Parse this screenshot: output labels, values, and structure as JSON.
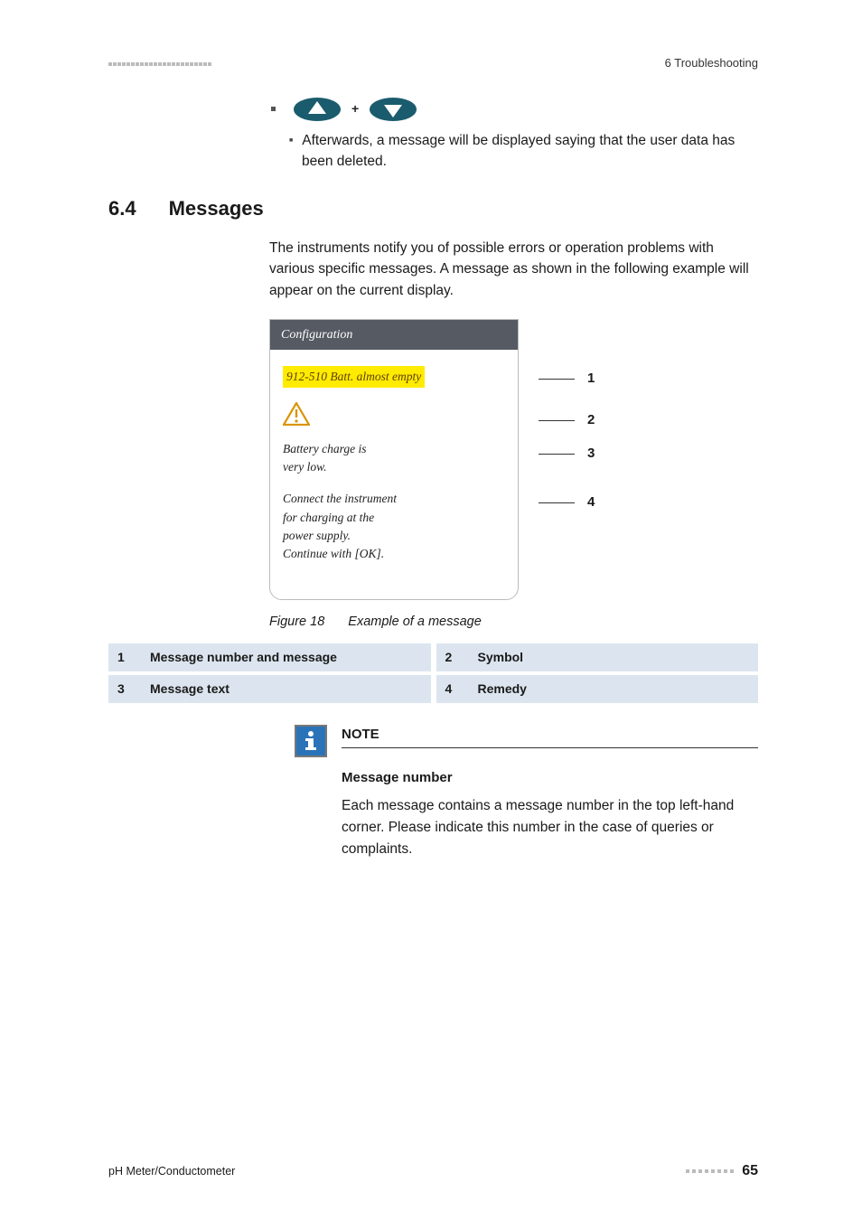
{
  "header": {
    "right": "6 Troubleshooting"
  },
  "step": {
    "plus": "+",
    "text": "Afterwards, a message will be displayed saying that the user data has been deleted."
  },
  "section": {
    "number": "6.4",
    "title": "Messages"
  },
  "intro": "The instruments notify you of possible errors or operation problems with various specific messages. A message as shown in the following example will appear on the current display.",
  "device": {
    "header": "Configuration",
    "message_code": "912-510 Batt. almost empty",
    "message_text_1": "Battery charge is",
    "message_text_2": "very low.",
    "remedy_1": "Connect the instrument",
    "remedy_2": "for charging at the",
    "remedy_3": "power supply.",
    "remedy_4": "Continue with [OK]."
  },
  "callouts": {
    "n1": "1",
    "n2": "2",
    "n3": "3",
    "n4": "4"
  },
  "figure": {
    "label": "Figure 18",
    "caption": "Example of a message"
  },
  "legend": {
    "r1n": "1",
    "r1t": "Message number and message",
    "r2n": "2",
    "r2t": "Symbol",
    "r3n": "3",
    "r3t": "Message text",
    "r4n": "4",
    "r4t": "Remedy"
  },
  "note": {
    "title": "NOTE",
    "subtitle": "Message number",
    "body": "Each message contains a message number in the top left-hand corner. Please indicate this number in the case of queries or complaints."
  },
  "footer": {
    "left": "pH Meter/Conductometer",
    "page": "65"
  }
}
